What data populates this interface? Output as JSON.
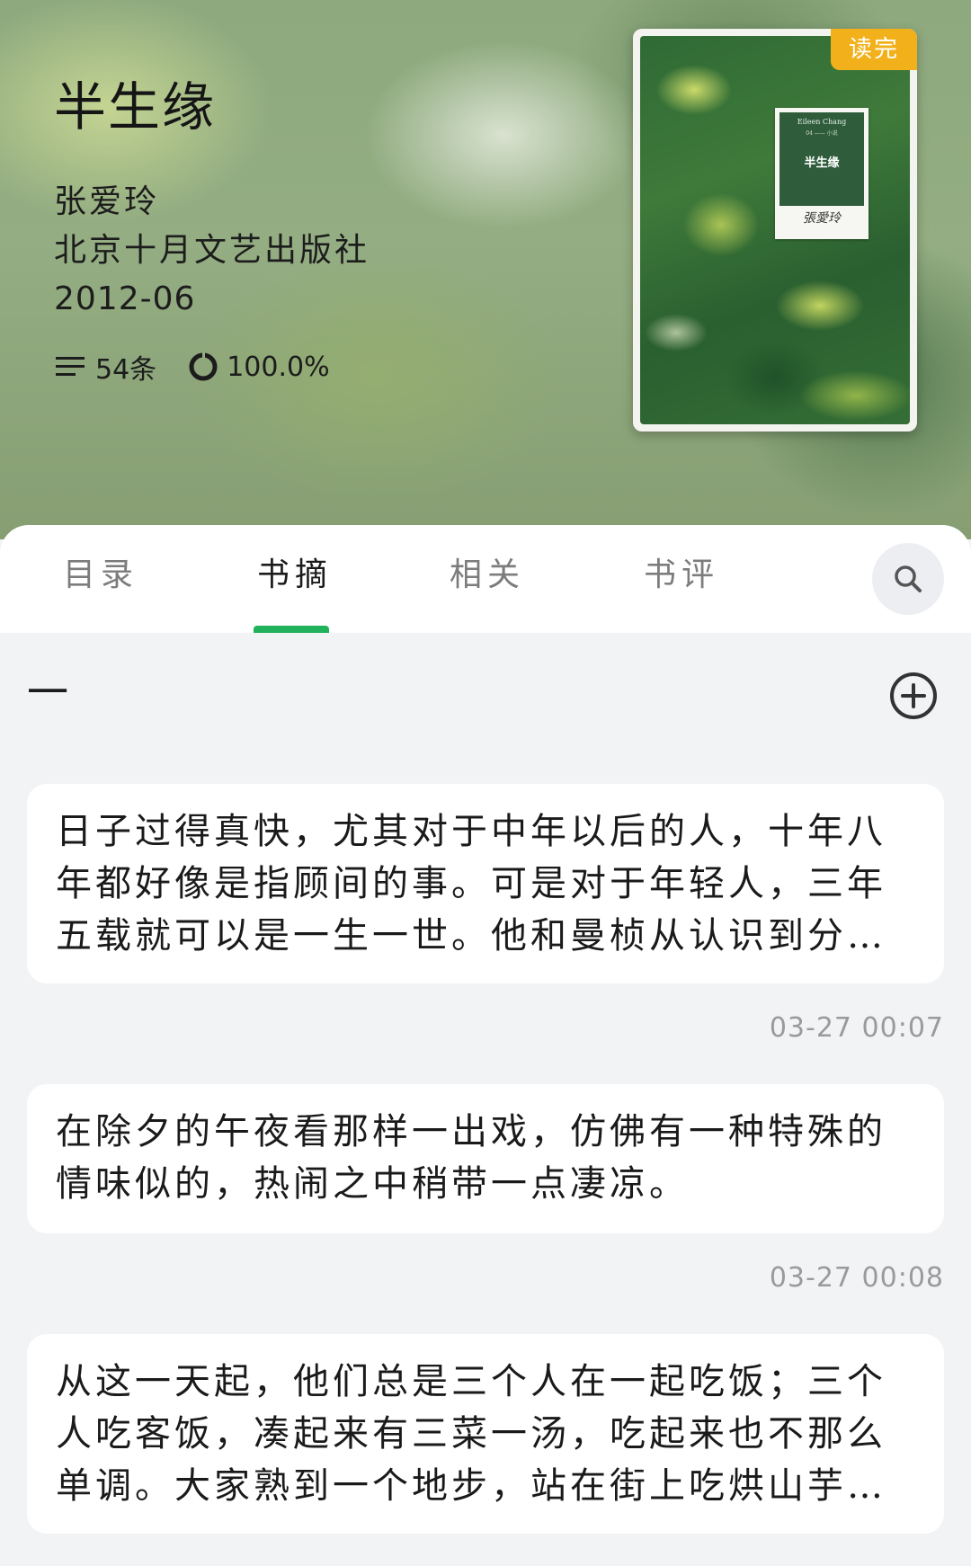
{
  "book": {
    "title": "半生缘",
    "author": "张爱玲",
    "publisher": "北京十月文艺出版社",
    "date": "2012-06",
    "notes_count": "54条",
    "progress": "100.0%",
    "badge": "读完"
  },
  "cover": {
    "english_name": "Eileen Chang",
    "series_mark": "04 —— 小说",
    "chinese_title": "半生缘",
    "signature": "張愛玲"
  },
  "tabs": [
    {
      "label": "目录"
    },
    {
      "label": "书摘"
    },
    {
      "label": "相关"
    },
    {
      "label": "书评"
    }
  ],
  "active_tab_index": 1,
  "section": {
    "title": "一"
  },
  "excerpts": [
    {
      "text": "日子过得真快，尤其对于中年以后的人，十年八年都好像是指顾间的事。可是对于年轻人，三年五载就可以是一生一世。他和曼桢从认识到分手，不过几年的工夫。",
      "time": "03-27 00:07"
    },
    {
      "text": "在除夕的午夜看那样一出戏，仿佛有一种特殊的情味似的，热闹之中稍带一点凄凉。",
      "time": "03-27 00:08"
    },
    {
      "text": "从这一天起，他们总是三个人在一起吃饭；三个人吃客饭，凑起来有三菜一汤，吃起来也不那么单调。大家熟到一个地步，站在街上吃烘山芋当一顿饭。",
      "time": ""
    }
  ],
  "colors": {
    "accent_green": "#21b35b",
    "badge_orange": "#f2b11a"
  },
  "icons": {
    "notes": "list-lines-icon",
    "progress": "progress-ring-icon",
    "search": "search-icon",
    "add": "plus-circle-icon"
  }
}
